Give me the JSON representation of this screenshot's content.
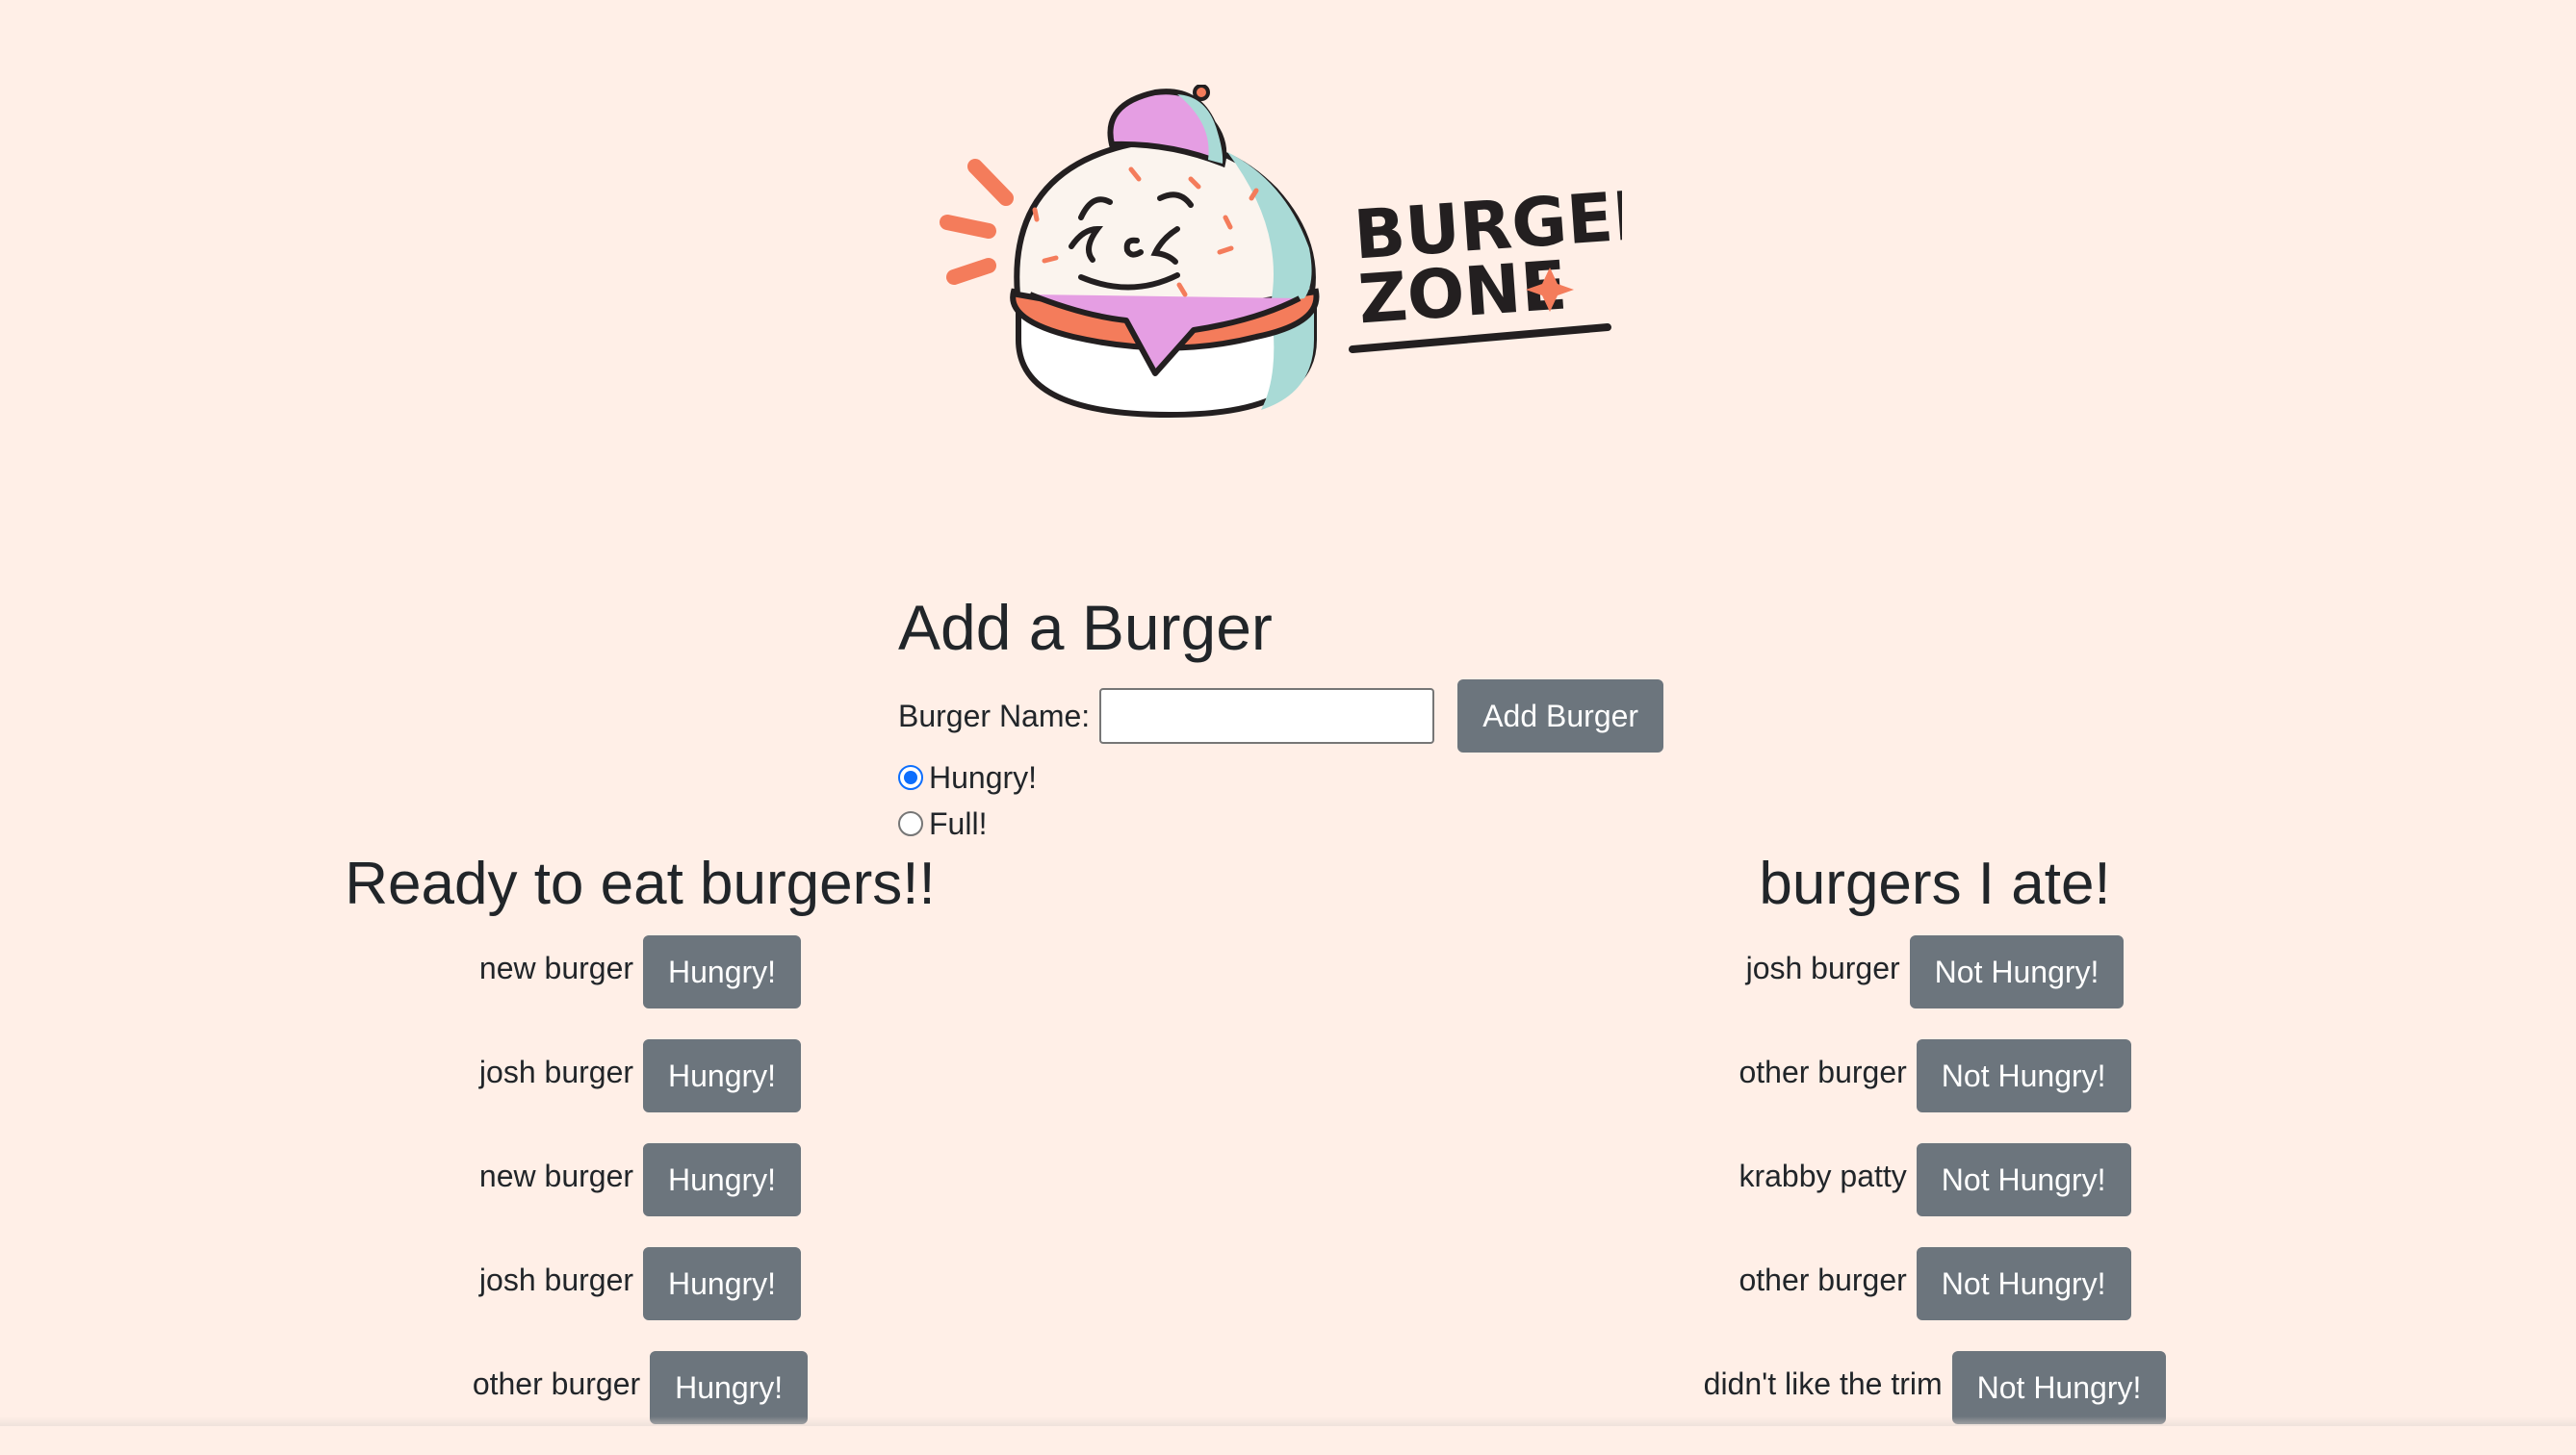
{
  "colors": {
    "background": "#ffefe7",
    "button": "#6c757d",
    "radio_accent": "#0d6efd",
    "text": "#212529"
  },
  "logo": {
    "line1": "BURGER",
    "line2": "ZONE",
    "icon": "burger-mascot-logo"
  },
  "add_form": {
    "title": "Add a Burger",
    "name_label": "Burger Name:",
    "name_value": "",
    "submit_label": "Add Burger",
    "radios": [
      {
        "label": "Hungry!",
        "checked": true
      },
      {
        "label": "Full!",
        "checked": false
      }
    ]
  },
  "ready_list": {
    "heading": "Ready to eat burgers!!",
    "items": [
      {
        "name": "new burger",
        "button": "Hungry!"
      },
      {
        "name": "josh burger",
        "button": "Hungry!"
      },
      {
        "name": "new burger",
        "button": "Hungry!"
      },
      {
        "name": "josh burger",
        "button": "Hungry!"
      },
      {
        "name": "other burger",
        "button": "Hungry!"
      }
    ]
  },
  "eaten_list": {
    "heading": "burgers I ate!",
    "items": [
      {
        "name": "josh burger",
        "button": "Not Hungry!"
      },
      {
        "name": "other burger",
        "button": "Not Hungry!"
      },
      {
        "name": "krabby patty",
        "button": "Not Hungry!"
      },
      {
        "name": "other burger",
        "button": "Not Hungry!"
      },
      {
        "name": "didn't like the trim",
        "button": "Not Hungry!"
      }
    ]
  }
}
